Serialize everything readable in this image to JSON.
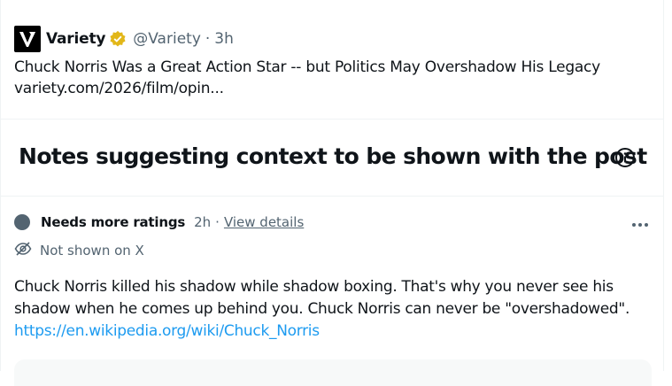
{
  "post": {
    "author": "Variety",
    "handle": "@Variety",
    "separator": "·",
    "time": "3h",
    "text": "Chuck Norris Was a Great Action Star -- but Politics May Overshadow His Legacy",
    "link_text": "variety.com/2026/film/opin..."
  },
  "notes": {
    "title": "Notes suggesting context to be shown with the post"
  },
  "note": {
    "status": "Needs more ratings",
    "time": "2h",
    "separator": "·",
    "view_details": "View details",
    "visibility": "Not shown on X",
    "body_line1": "Chuck Norris killed his shadow while shadow boxing. That's why you never see his",
    "body_line2": "shadow when he comes up behind you. Chuck Norris can never be \"overshadowed\".",
    "link": "https://en.wikipedia.org/wiki/Chuck_Norris"
  },
  "colors": {
    "text": "#0f1419",
    "secondary": "#536471",
    "link": "#1d9bf0",
    "verified_badge": "#e2b719",
    "divider": "#eff3f4"
  },
  "icons": {
    "logo": "variety-logo-icon",
    "verified": "verified-badge-icon",
    "info": "info-icon",
    "more": "more-icon",
    "eye_off": "eye-off-icon"
  }
}
